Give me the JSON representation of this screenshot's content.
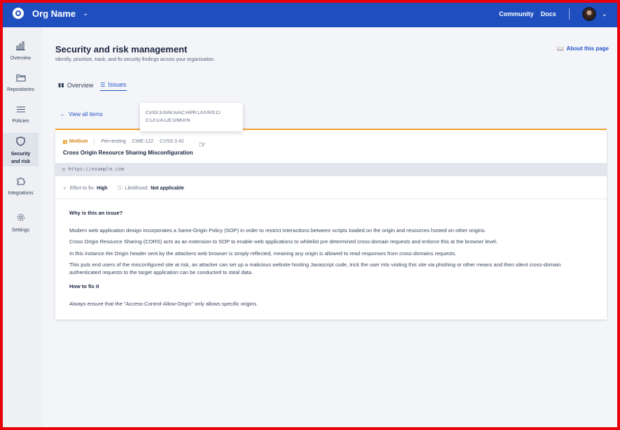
{
  "topbar": {
    "org_name": "Org Name",
    "links": [
      "Community",
      "Docs"
    ]
  },
  "sidebar": {
    "items": [
      {
        "label": "Overview",
        "icon": "bar-chart-icon"
      },
      {
        "label": "Repositories",
        "icon": "folder-icon"
      },
      {
        "label": "Policies",
        "icon": "list-icon"
      },
      {
        "label": "Security and risk",
        "icon": "shield-icon",
        "active": true
      },
      {
        "label": "Integrations",
        "icon": "puzzle-icon"
      },
      {
        "label": "Settings",
        "icon": "gear-icon"
      }
    ]
  },
  "page": {
    "title": "Security and risk management",
    "subtitle": "Identify, prioritize, track, and fix security findings across your organization.",
    "about": "About this page",
    "tabs": [
      {
        "label": "Overview",
        "active": false
      },
      {
        "label": "Issues",
        "active": true
      }
    ],
    "view_all": "View all items"
  },
  "tooltip": {
    "line1": "CVSS:3.0/AV:A/AC:H/PR:L/UI:R/S:C/",
    "line2": "C:L/I:L/A:L/E:U/MUI:N"
  },
  "issue": {
    "severity": "Medium",
    "source": "Pen-testing",
    "cwe": "CWE-122",
    "cvss": "CVSS 0.42",
    "title": "Cross Origin Resource Sharing Misconfiguration",
    "url": "https://example.com",
    "effort_label": "Effort to fix:",
    "effort_value": "High",
    "likelihood_label": "Likelihood:",
    "likelihood_value": "Not applicable",
    "why_heading": "Why is this an issue?",
    "why_paragraphs": [
      "Modern web application design incorporates a Same-Origin Policy (SOP) in order to restrict interactions between scripts loaded on the origin and resources hosted on other origins.",
      "Cross Origin Resource Sharing (CORS) acts as an extension to SOP to enable web applications to whitelist pre determined cross-domain requests and enforce this at the browser level.",
      "In this instance the Origin header sent by the attackers web browser is simply reflected, meaning any origin is allowed to read responses from cross-domains requests.",
      "This puts end users of the misconfigured site at risk, an attacker can set up a malicious website hosting Javascript code, trick the user into visiting this site via phishing or other means and then silent cross-domain authenticated requests to the target application can be conducted to steal data."
    ],
    "fix_heading": "How to fix it",
    "fix_text": "Always ensure that the \"Access-Control-Allow-Origin\" only allows specific origins."
  }
}
